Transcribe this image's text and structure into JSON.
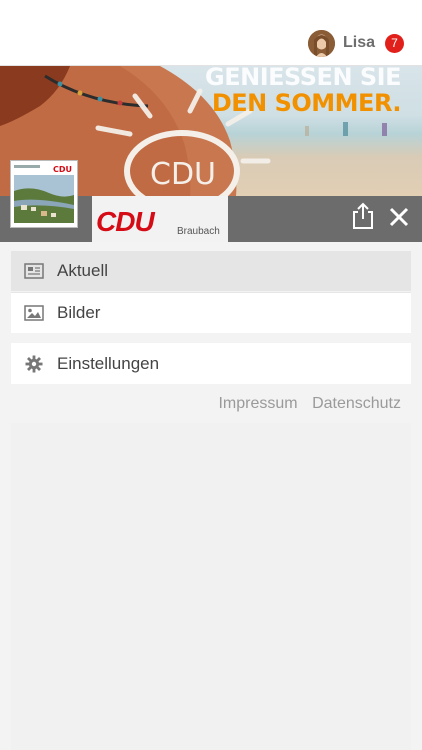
{
  "header": {
    "username": "Lisa",
    "notification_count": "7",
    "avatar_icon": "user-avatar"
  },
  "banner": {
    "line1": "GENIESSEN SIE",
    "line2": "DEN SOMMER.",
    "sunscreen_text": "CDU",
    "thumb_logo": "CDU"
  },
  "brand": {
    "logo": "CDU",
    "subtitle": "Braubach",
    "logo_color": "#d50b16"
  },
  "toolbar": {
    "share_icon": "share-icon",
    "close_icon": "close-icon"
  },
  "menu": {
    "items": [
      {
        "label": "Aktuell",
        "icon": "newspaper-icon",
        "active": true
      },
      {
        "label": "Bilder",
        "icon": "image-icon",
        "active": false
      },
      {
        "label": "Einstellungen",
        "icon": "gear-icon",
        "active": false
      }
    ]
  },
  "footer": {
    "impressum": "Impressum",
    "datenschutz": "Datenschutz"
  },
  "colors": {
    "accent": "#e2201b",
    "strip": "#6c6c6c",
    "slogan_orange": "#f29100"
  }
}
